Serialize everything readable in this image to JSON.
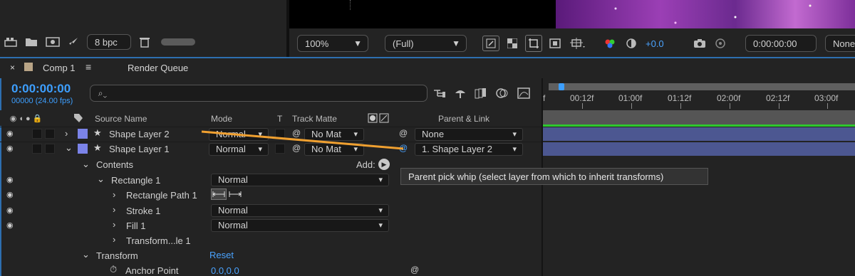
{
  "toolbar_left": {
    "bit_depth": "8 bpc"
  },
  "viewer_toolbar": {
    "zoom": "100%",
    "resolution": "(Full)",
    "exposure": "+0.0",
    "timecode": "0:00:00:00",
    "view": "None"
  },
  "tabs": {
    "comp": "Comp 1",
    "render_queue": "Render Queue"
  },
  "timeline": {
    "current_time": "0:00:00:00",
    "fps": "00000 (24.00 fps)",
    "ruler": [
      "f",
      "00:12f",
      "01:00f",
      "01:12f",
      "02:00f",
      "02:12f",
      "03:00f"
    ]
  },
  "columns": {
    "source_name": "Source Name",
    "mode": "Mode",
    "t": "T",
    "track_matte": "Track Matte",
    "parent_link": "Parent & Link"
  },
  "layers": [
    {
      "name": "Shape Layer 2",
      "mode": "Normal",
      "matte": "No Mat",
      "parent": "None"
    },
    {
      "name": "Shape Layer 1",
      "mode": "Normal",
      "matte": "No Mat",
      "parent": "1. Shape Layer 2"
    }
  ],
  "properties": {
    "contents": "Contents",
    "add": "Add:",
    "rectangle": "Rectangle 1",
    "rectangle_mode": "Normal",
    "rect_path": "Rectangle Path 1",
    "stroke": "Stroke 1",
    "stroke_mode": "Normal",
    "fill": "Fill 1",
    "fill_mode": "Normal",
    "transform_le": "Transform...le 1",
    "transform": "Transform",
    "reset": "Reset",
    "anchor_point": "Anchor Point",
    "anchor_value": "0.0,0.0"
  },
  "tooltip": "Parent pick whip (select layer from which to inherit transforms)",
  "colors": {
    "accent_blue": "#3d9fff",
    "label_blue": "#7b83e8",
    "track_blue": "#4c5791",
    "pickwhip_orange": "#f0a030",
    "green_line": "#2ec82e"
  }
}
